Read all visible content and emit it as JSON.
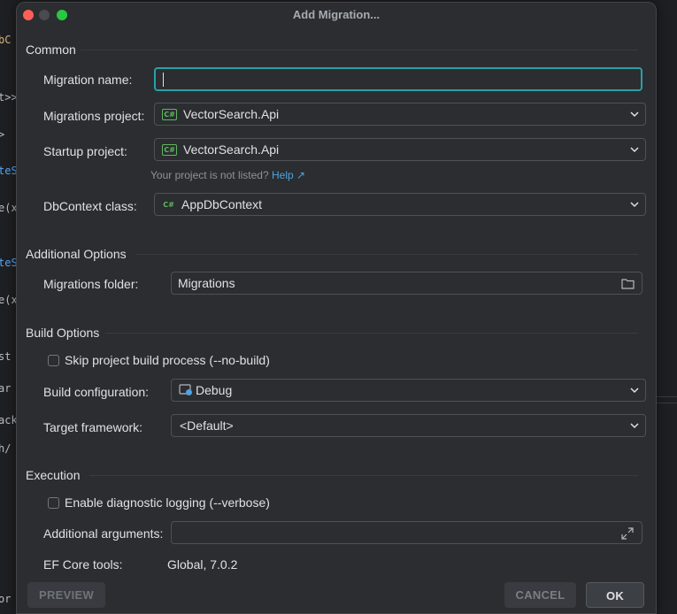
{
  "dialog": {
    "title": "Add Migration..."
  },
  "sections": {
    "common": "Common",
    "additional": "Additional Options",
    "build": "Build Options",
    "execution": "Execution"
  },
  "fields": {
    "migration_name": {
      "label": "Migration name:",
      "value": ""
    },
    "migrations_project": {
      "label": "Migrations project:",
      "value": "VectorSearch.Api",
      "icon": "csharp-project-icon"
    },
    "startup_project": {
      "label": "Startup project:",
      "value": "VectorSearch.Api",
      "icon": "csharp-project-icon"
    },
    "hint": {
      "text": "Your project is not listed?",
      "link": "Help",
      "link_icon": "↗"
    },
    "dbcontext": {
      "label": "DbContext class:",
      "value": "AppDbContext",
      "icon": "csharp-class-icon"
    },
    "migrations_folder": {
      "label": "Migrations folder:",
      "value": "Migrations",
      "icon": "folder-icon"
    },
    "skip_build": {
      "label": "Skip project build process (--no-build)",
      "checked": false
    },
    "build_configuration": {
      "label": "Build configuration:",
      "value": "Debug",
      "icon": "debug-config-icon"
    },
    "target_framework": {
      "label": "Target framework:",
      "value": "<Default>"
    },
    "diagnostic_logging": {
      "label": "Enable diagnostic logging (--verbose)",
      "checked": false
    },
    "additional_arguments": {
      "label": "Additional arguments:",
      "value": "",
      "icon": "expand-icon"
    },
    "ef_core_tools": {
      "label": "EF Core tools:",
      "value": "Global, 7.0.2"
    }
  },
  "buttons": {
    "preview": "PREVIEW",
    "cancel": "CANCEL",
    "ok": "OK"
  },
  "background_code": [
    "bC",
    "t>>",
    ">",
    "teS",
    "e(x",
    "teS",
    "e(x",
    "st",
    "ar",
    "ack",
    "h/",
    "or"
  ],
  "colors": {
    "accent": "#2a9fa6",
    "link": "#4fa3e0",
    "csharp": "#5fb85f"
  }
}
